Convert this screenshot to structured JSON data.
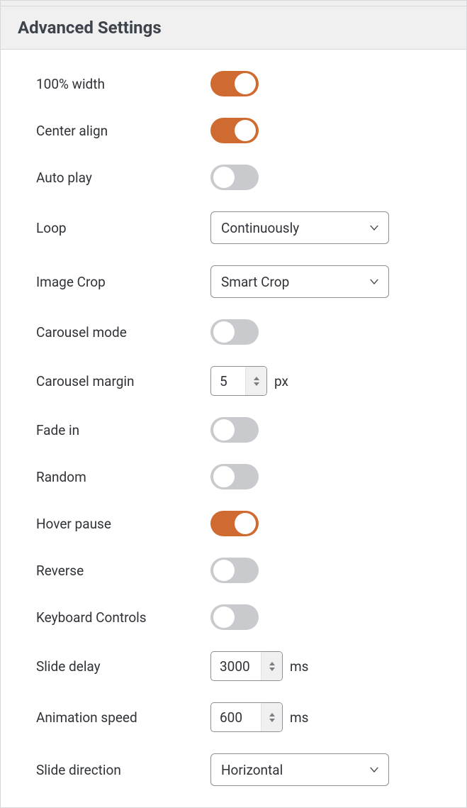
{
  "panel": {
    "title": "Advanced Settings"
  },
  "settings": {
    "width_100": {
      "label": "100% width",
      "on": true
    },
    "center_align": {
      "label": "Center align",
      "on": true
    },
    "auto_play": {
      "label": "Auto play",
      "on": false
    },
    "loop": {
      "label": "Loop",
      "value": "Continuously"
    },
    "image_crop": {
      "label": "Image Crop",
      "value": "Smart Crop"
    },
    "carousel_mode": {
      "label": "Carousel mode",
      "on": false
    },
    "carousel_margin": {
      "label": "Carousel margin",
      "value": "5",
      "unit": "px"
    },
    "fade_in": {
      "label": "Fade in",
      "on": false
    },
    "random": {
      "label": "Random",
      "on": false
    },
    "hover_pause": {
      "label": "Hover pause",
      "on": true
    },
    "reverse": {
      "label": "Reverse",
      "on": false
    },
    "keyboard_controls": {
      "label": "Keyboard Controls",
      "on": false
    },
    "slide_delay": {
      "label": "Slide delay",
      "value": "3000",
      "unit": "ms"
    },
    "animation_speed": {
      "label": "Animation speed",
      "value": "600",
      "unit": "ms"
    },
    "slide_direction": {
      "label": "Slide direction",
      "value": "Horizontal"
    }
  }
}
